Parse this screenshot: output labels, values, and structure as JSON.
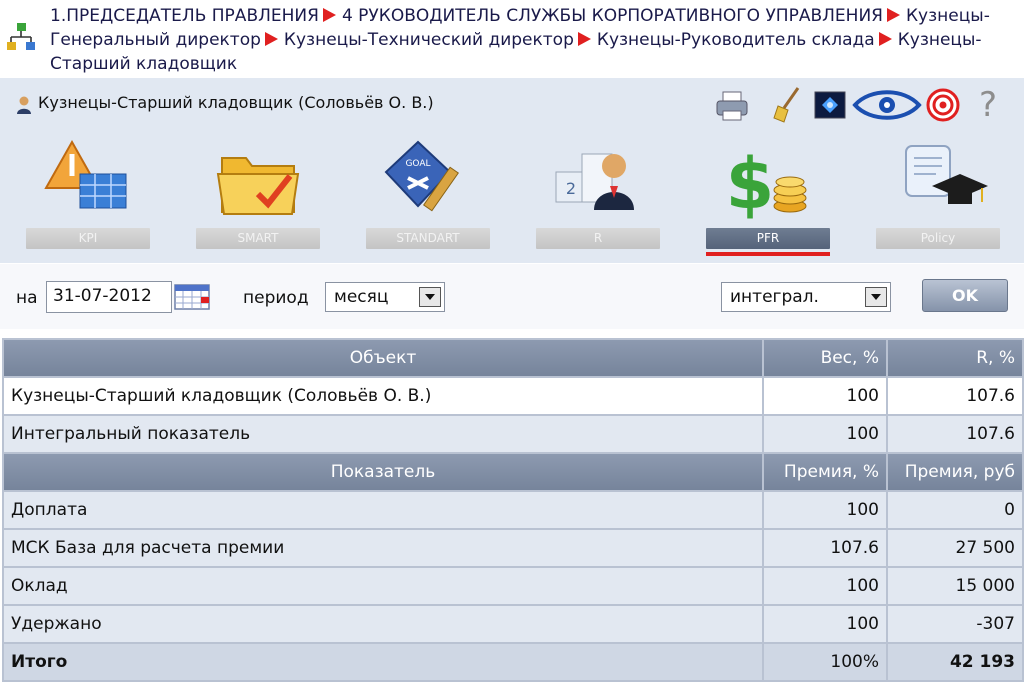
{
  "breadcrumb": {
    "items": [
      "1.ПРЕДСЕДАТЕЛЬ ПРАВЛЕНИЯ",
      "4 РУКОВОДИТЕЛЬ СЛУЖБЫ КОРПОРАТИВНОГО УПРАВЛЕНИЯ",
      "Кузнецы-Генеральный директор",
      "Кузнецы-Технический директор",
      "Кузнецы-Руководитель склада",
      "Кузнецы-Старший кладовщик"
    ]
  },
  "header": {
    "user_line": "Кузнецы-Старший кладовщик  (Соловьёв О. В.)",
    "help_label": "?"
  },
  "modules": {
    "kpi": "KPI",
    "smart": "SMART",
    "standart": "STANDART",
    "r": "R",
    "pfr": "PFR",
    "policy": "Policy",
    "goal_badge": "GOAL",
    "rank_2": "2"
  },
  "filter": {
    "on_label": "на",
    "date": "31-07-2012",
    "period_label": "период",
    "period_value": "месяц",
    "mode_value": "интеграл.",
    "ok_label": "OK"
  },
  "table": {
    "head1": [
      "Объект",
      "Вес, %",
      "R, %"
    ],
    "rows1": [
      [
        "Кузнецы-Старший кладовщик (Соловьёв О. В.)",
        "100",
        "107.6"
      ],
      [
        "Интегральный показатель",
        "100",
        "107.6"
      ]
    ],
    "head2": [
      "Показатель",
      "Премия, %",
      "Премия, руб"
    ],
    "rows2": [
      [
        "Доплата",
        "100",
        "0"
      ],
      [
        "МСК База для расчета премии",
        "107.6",
        "27 500"
      ],
      [
        "Оклад",
        "100",
        "15 000"
      ],
      [
        "Удержано",
        "100",
        "-307"
      ]
    ],
    "total": [
      "Итого",
      "100%",
      "42 193"
    ]
  },
  "colors": {
    "accent_red": "#e02020",
    "header_bg": "#76849b",
    "panel_bg": "#e1e8f2"
  }
}
